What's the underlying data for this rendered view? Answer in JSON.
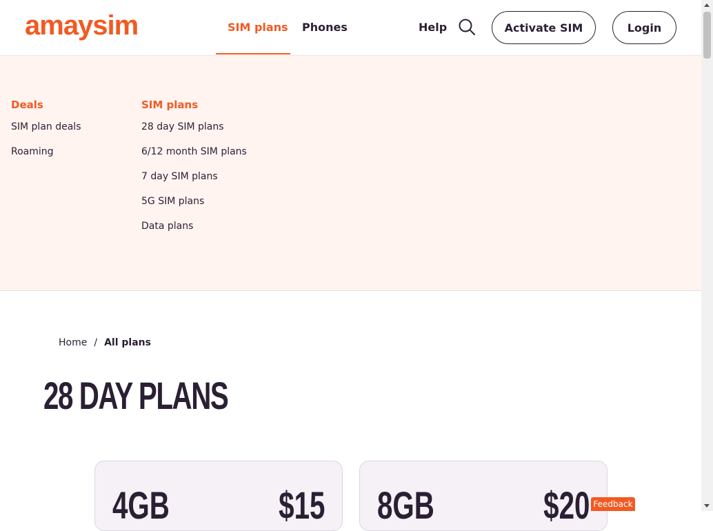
{
  "header": {
    "logo_text": "amaysim",
    "brand_color": "#f15a22",
    "nav": {
      "sim_plans": "SIM plans",
      "phones": "Phones",
      "help": "Help"
    },
    "activate_button": "Activate SIM",
    "login_button": "Login",
    "search_icon": "search-icon"
  },
  "mega_menu": {
    "deals": {
      "heading": "Deals",
      "links": [
        "SIM plan deals",
        "Roaming"
      ]
    },
    "sim_plans": {
      "heading": "SIM plans",
      "links": [
        "28 day SIM plans",
        "6/12 month SIM plans",
        "7 day SIM plans",
        "5G SIM plans",
        "Data plans"
      ]
    }
  },
  "breadcrumb": {
    "home": "Home",
    "separator": "/",
    "current": "All plans"
  },
  "page": {
    "title": "28 DAY PLANS"
  },
  "plans": [
    {
      "data": "4GB",
      "price": "$15"
    },
    {
      "data": "8GB",
      "price": "$20"
    }
  ],
  "feedback_label": "Feedback"
}
